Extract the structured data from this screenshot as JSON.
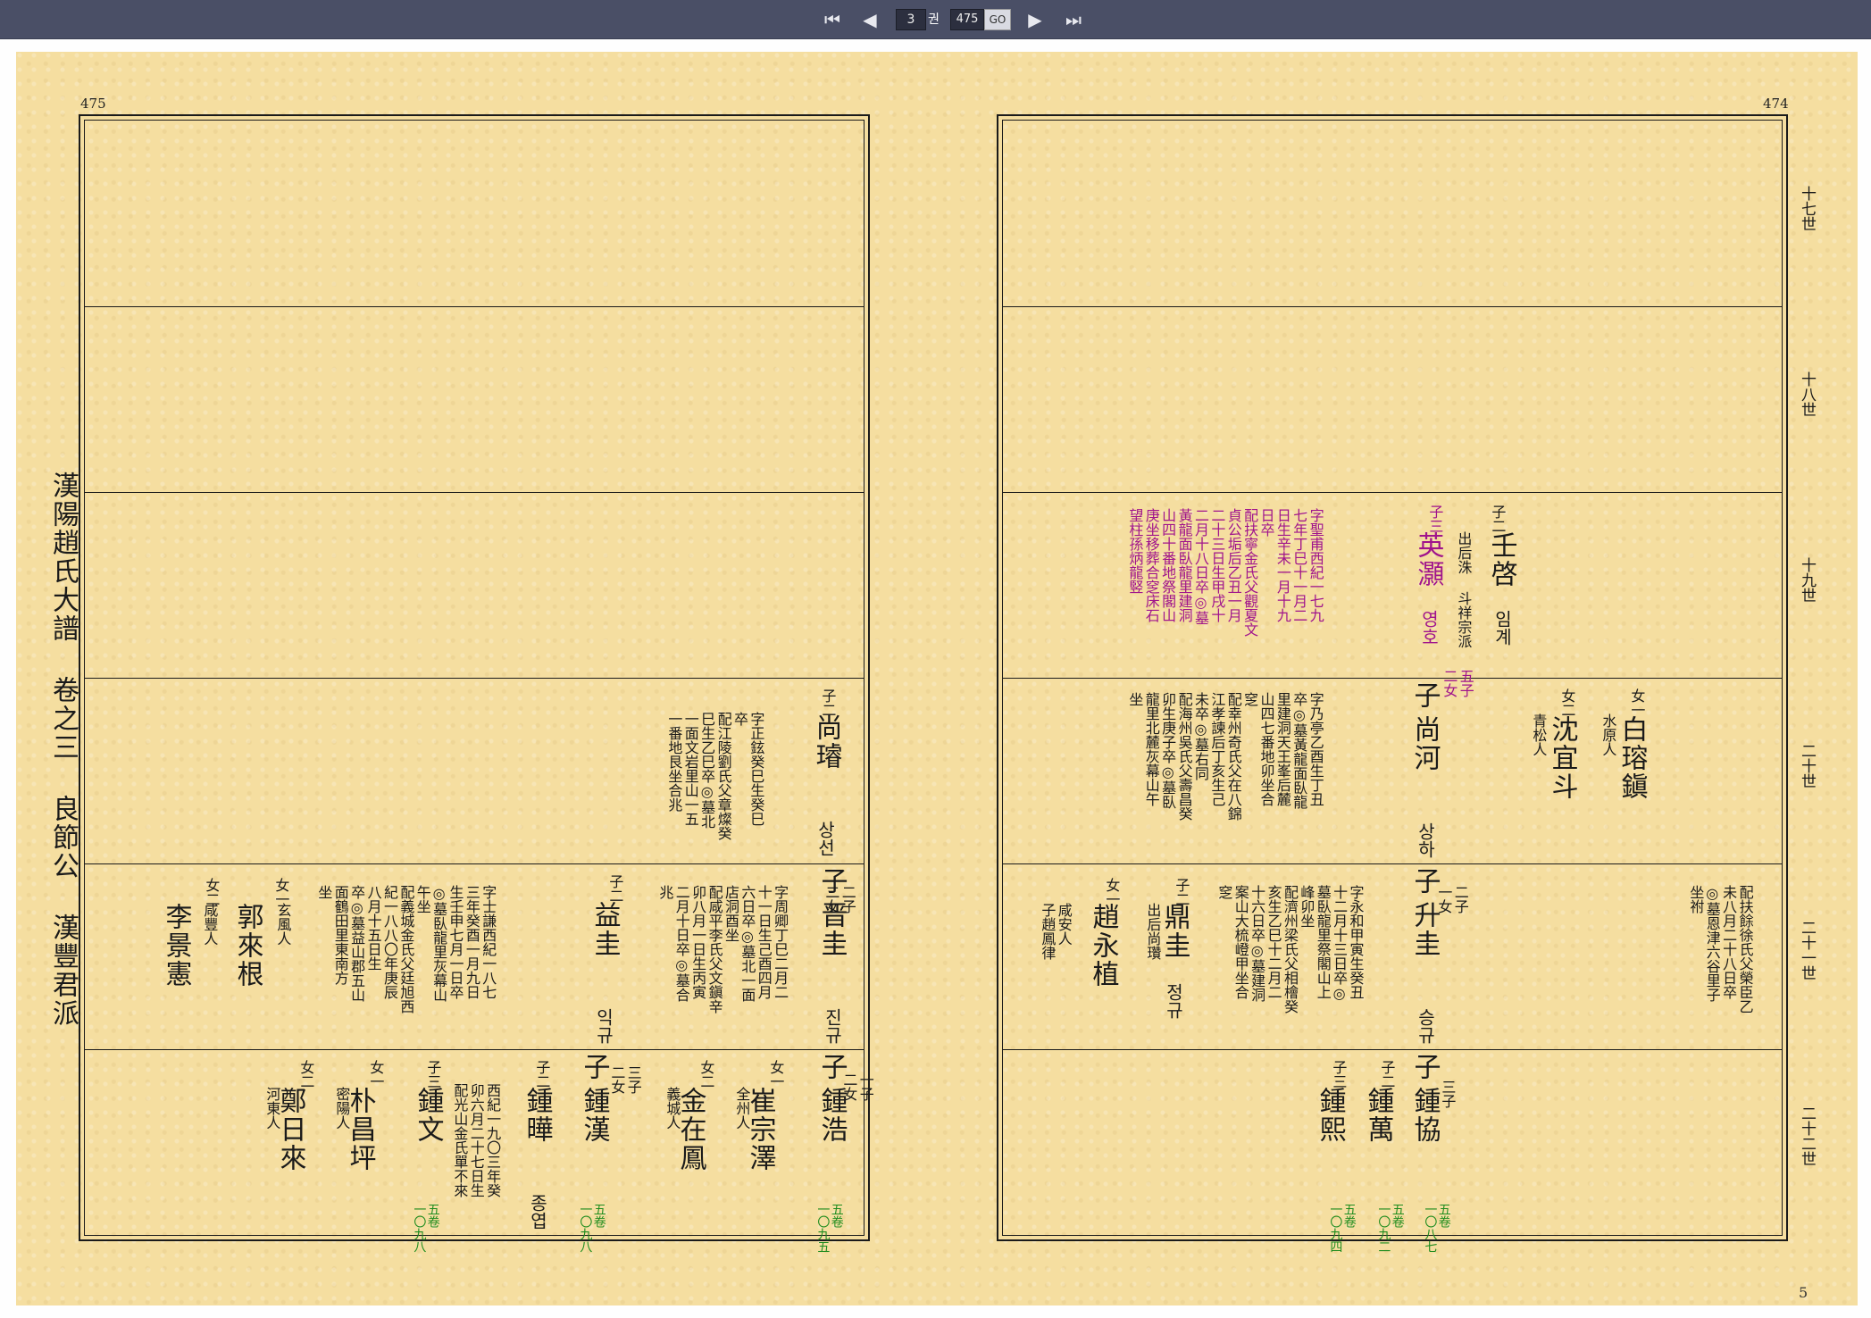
{
  "toolbar": {
    "first_icon": "⏮",
    "prev_icon": "◀",
    "next_icon": "▶",
    "last_icon": "⏭",
    "volume_value": "3",
    "volume_unit": "권",
    "page_value": "475",
    "go_label": "GO"
  },
  "page": {
    "left_number": "475",
    "right_number": "474",
    "side_title": "漢陽趙氏大譜 卷之三 良節公 漢豐君派",
    "footer_mark": "5"
  },
  "generations": [
    "十七世",
    "十八世",
    "十九世",
    "二十世",
    "二十一世",
    "二十二世"
  ],
  "right": {
    "imgye": {
      "rel": "子二",
      "name": "壬啓",
      "ko": "임계",
      "note": "出后洙 斗祥宗派"
    },
    "youngho": {
      "rel": "子三",
      "name": "英灝",
      "ko": "영호",
      "kids": "五子\n二女",
      "text": "字聖甫西紀一七九\n七年丁巳十一月二\n日生辛未一月十九\n日卒\n配扶寧金氏父觀夏文\n貞公垢后乙丑一月\n二十三日生甲戌十\n二月十八日卒◎墓\n黃龍面臥龍里建洞\n山四十番地祭閣山\n庚坐移葬合窆床石\n望柱孫炳龍竪"
    },
    "sangha": {
      "rel": "子",
      "name": "尚河",
      "ko": "상하",
      "kids": "二子\n一女",
      "text": "字乃亭乙酉生丁丑\n卒◎墓黃龍面臥龍\n里建洞天王峯后麓\n山四七番地卯坐合\n窆\n配幸州奇氏父在八錦\n江孝諫后丁亥生己\n未卒◎墓右同\n配海州吳氏父壽昌癸\n卯生庚子卒◎墓臥\n龍里北麓灰幕山午\n坐"
    },
    "baek": {
      "rel": "女一",
      "name": "白瑢鎭",
      "note": "水原人"
    },
    "sim": {
      "rel": "女二",
      "name": "沈宜斗",
      "note": "青松人"
    },
    "seunggyu": {
      "rel": "子",
      "name": "升圭",
      "ko": "승규",
      "kids": "三子",
      "text": "字永和甲寅生癸丑\n十二月十三日卒◎\n墓臥龍里祭閣山上\n峰卯坐\n配濟州梁氏父相檜癸\n亥生乙巳十二月二\n十六日卒◎墓建洞\n案山大梳嶝甲坐合\n窆"
    },
    "jeonggyu": {
      "rel": "子二",
      "name": "鼎圭",
      "ko": "정규",
      "note": "出后尚瓚"
    },
    "joyoung": {
      "rel": "女一",
      "name": "趙永植",
      "note": "咸安人\n子趙鳳律"
    },
    "seo": {
      "text": "配扶餘徐氏父榮臣乙\n未八月二十八日卒\n◎墓恩津六谷里子\n坐祔"
    },
    "jonghyeop": {
      "rel": "子",
      "name": "鍾協",
      "ref": "五卷\n一〇八七"
    },
    "jongman": {
      "rel": "子二",
      "name": "鍾萬",
      "ref": "五卷\n一〇九二"
    },
    "jonghui": {
      "rel": "子三",
      "name": "鍾熙",
      "ref": "五卷\n一〇九四"
    }
  },
  "left": {
    "sangseon": {
      "rel": "子二",
      "name": "尚璿",
      "ko": "상선",
      "kids": "二子\n二女",
      "text": "字正鉉癸巳生癸巳\n卒\n配江陵劉氏父章燦癸\n巳生乙巳卒◎墓北\n一面文岩里山一五\n一番地艮坐合兆"
    },
    "jingyu": {
      "rel": "子",
      "name": "晋圭",
      "ko": "진규",
      "kids": "一子\n二女",
      "text": "字周卿丁巳二月二\n十一日生己酉四月\n六日卒◎墓北一面\n店洞酉坐\n配咸平李氏父文鎭辛\n卯八月一日生丙寅\n二月十日卒◎墓合\n兆"
    },
    "ikgyu": {
      "rel": "子二",
      "name": "益圭",
      "ko": "익규",
      "kids": "三子\n二女",
      "text": "字士謙西紀一八七\n三年癸酉一月九日\n生壬申七月一日卒\n◎墓臥龍里灰幕山\n午坐\n配義城金氏父廷旭西\n紀一八八〇年庚辰\n八月十五日生\n卒◎墓益山郡五山\n面鶴田里東南方\n坐"
    },
    "gwak": {
      "rel": "女一",
      "name": "郭來根",
      "note": "玄風人"
    },
    "lee": {
      "rel": "女二",
      "name": "李景憲",
      "note": "咸豐人"
    },
    "jongho": {
      "rel": "子",
      "name": "鍾浩",
      "ref": "五卷\n一〇九五"
    },
    "choi": {
      "rel": "女一",
      "name": "崔宗澤",
      "note": "全州人"
    },
    "kim": {
      "rel": "女二",
      "name": "金在鳳",
      "note": "義城人"
    },
    "jonghan": {
      "rel": "子",
      "name": "鍾漢",
      "ref": "五卷\n一〇九八"
    },
    "jongyeop": {
      "rel": "子二",
      "name": "鍾曄",
      "ko": "종엽",
      "text": "西紀一九〇三年癸\n卯六月二十七日生\n配光山金氏單不來"
    },
    "jongmun": {
      "rel": "子三",
      "name": "鍾文",
      "ref": "五卷\n一〇九八"
    },
    "park": {
      "rel": "女一",
      "name": "朴昌坪",
      "note": "密陽人"
    },
    "jeong": {
      "rel": "女二",
      "name": "鄭日來",
      "note": "河東人"
    }
  }
}
